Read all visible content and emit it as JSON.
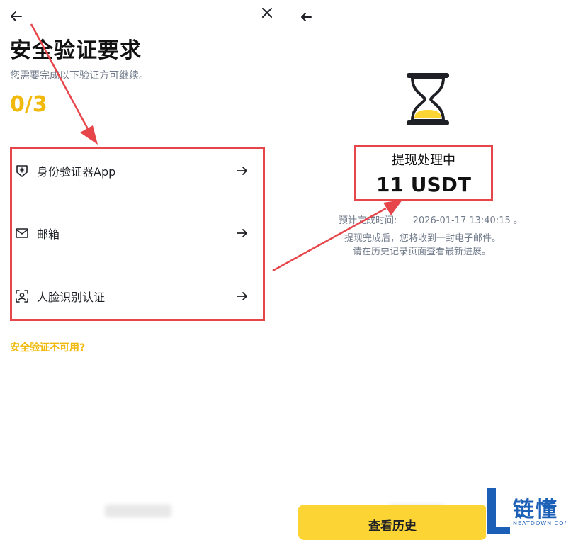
{
  "left_panel": {
    "title": "安全验证要求",
    "subtitle": "您需要完成以下验证方可继续。",
    "progress": "0/3",
    "options": [
      {
        "label": "身份验证器App",
        "icon": "authenticator-shield-icon"
      },
      {
        "label": "邮箱",
        "icon": "envelope-icon"
      },
      {
        "label": "人脸识别认证",
        "icon": "face-scan-icon"
      }
    ],
    "unavailable_link": "安全验证不可用?"
  },
  "right_panel": {
    "status_title": "提现处理中",
    "amount": "11 USDT",
    "eta_label": "预计完成时间:",
    "eta_value": "2026-01-17 13:40:15 。",
    "note_line1": "提现完成后，您将收到一封电子邮件。",
    "note_line2": "请在历史记录页面查看最新进展。",
    "history_button": "查看历史"
  },
  "watermark": {
    "brand": "链懂",
    "site": "NEATDOWN.COM"
  },
  "colors": {
    "accent": "#f0b90b",
    "button_bg": "#fcd535",
    "annotation_red": "#e6454a",
    "muted_text": "#707a8a"
  }
}
